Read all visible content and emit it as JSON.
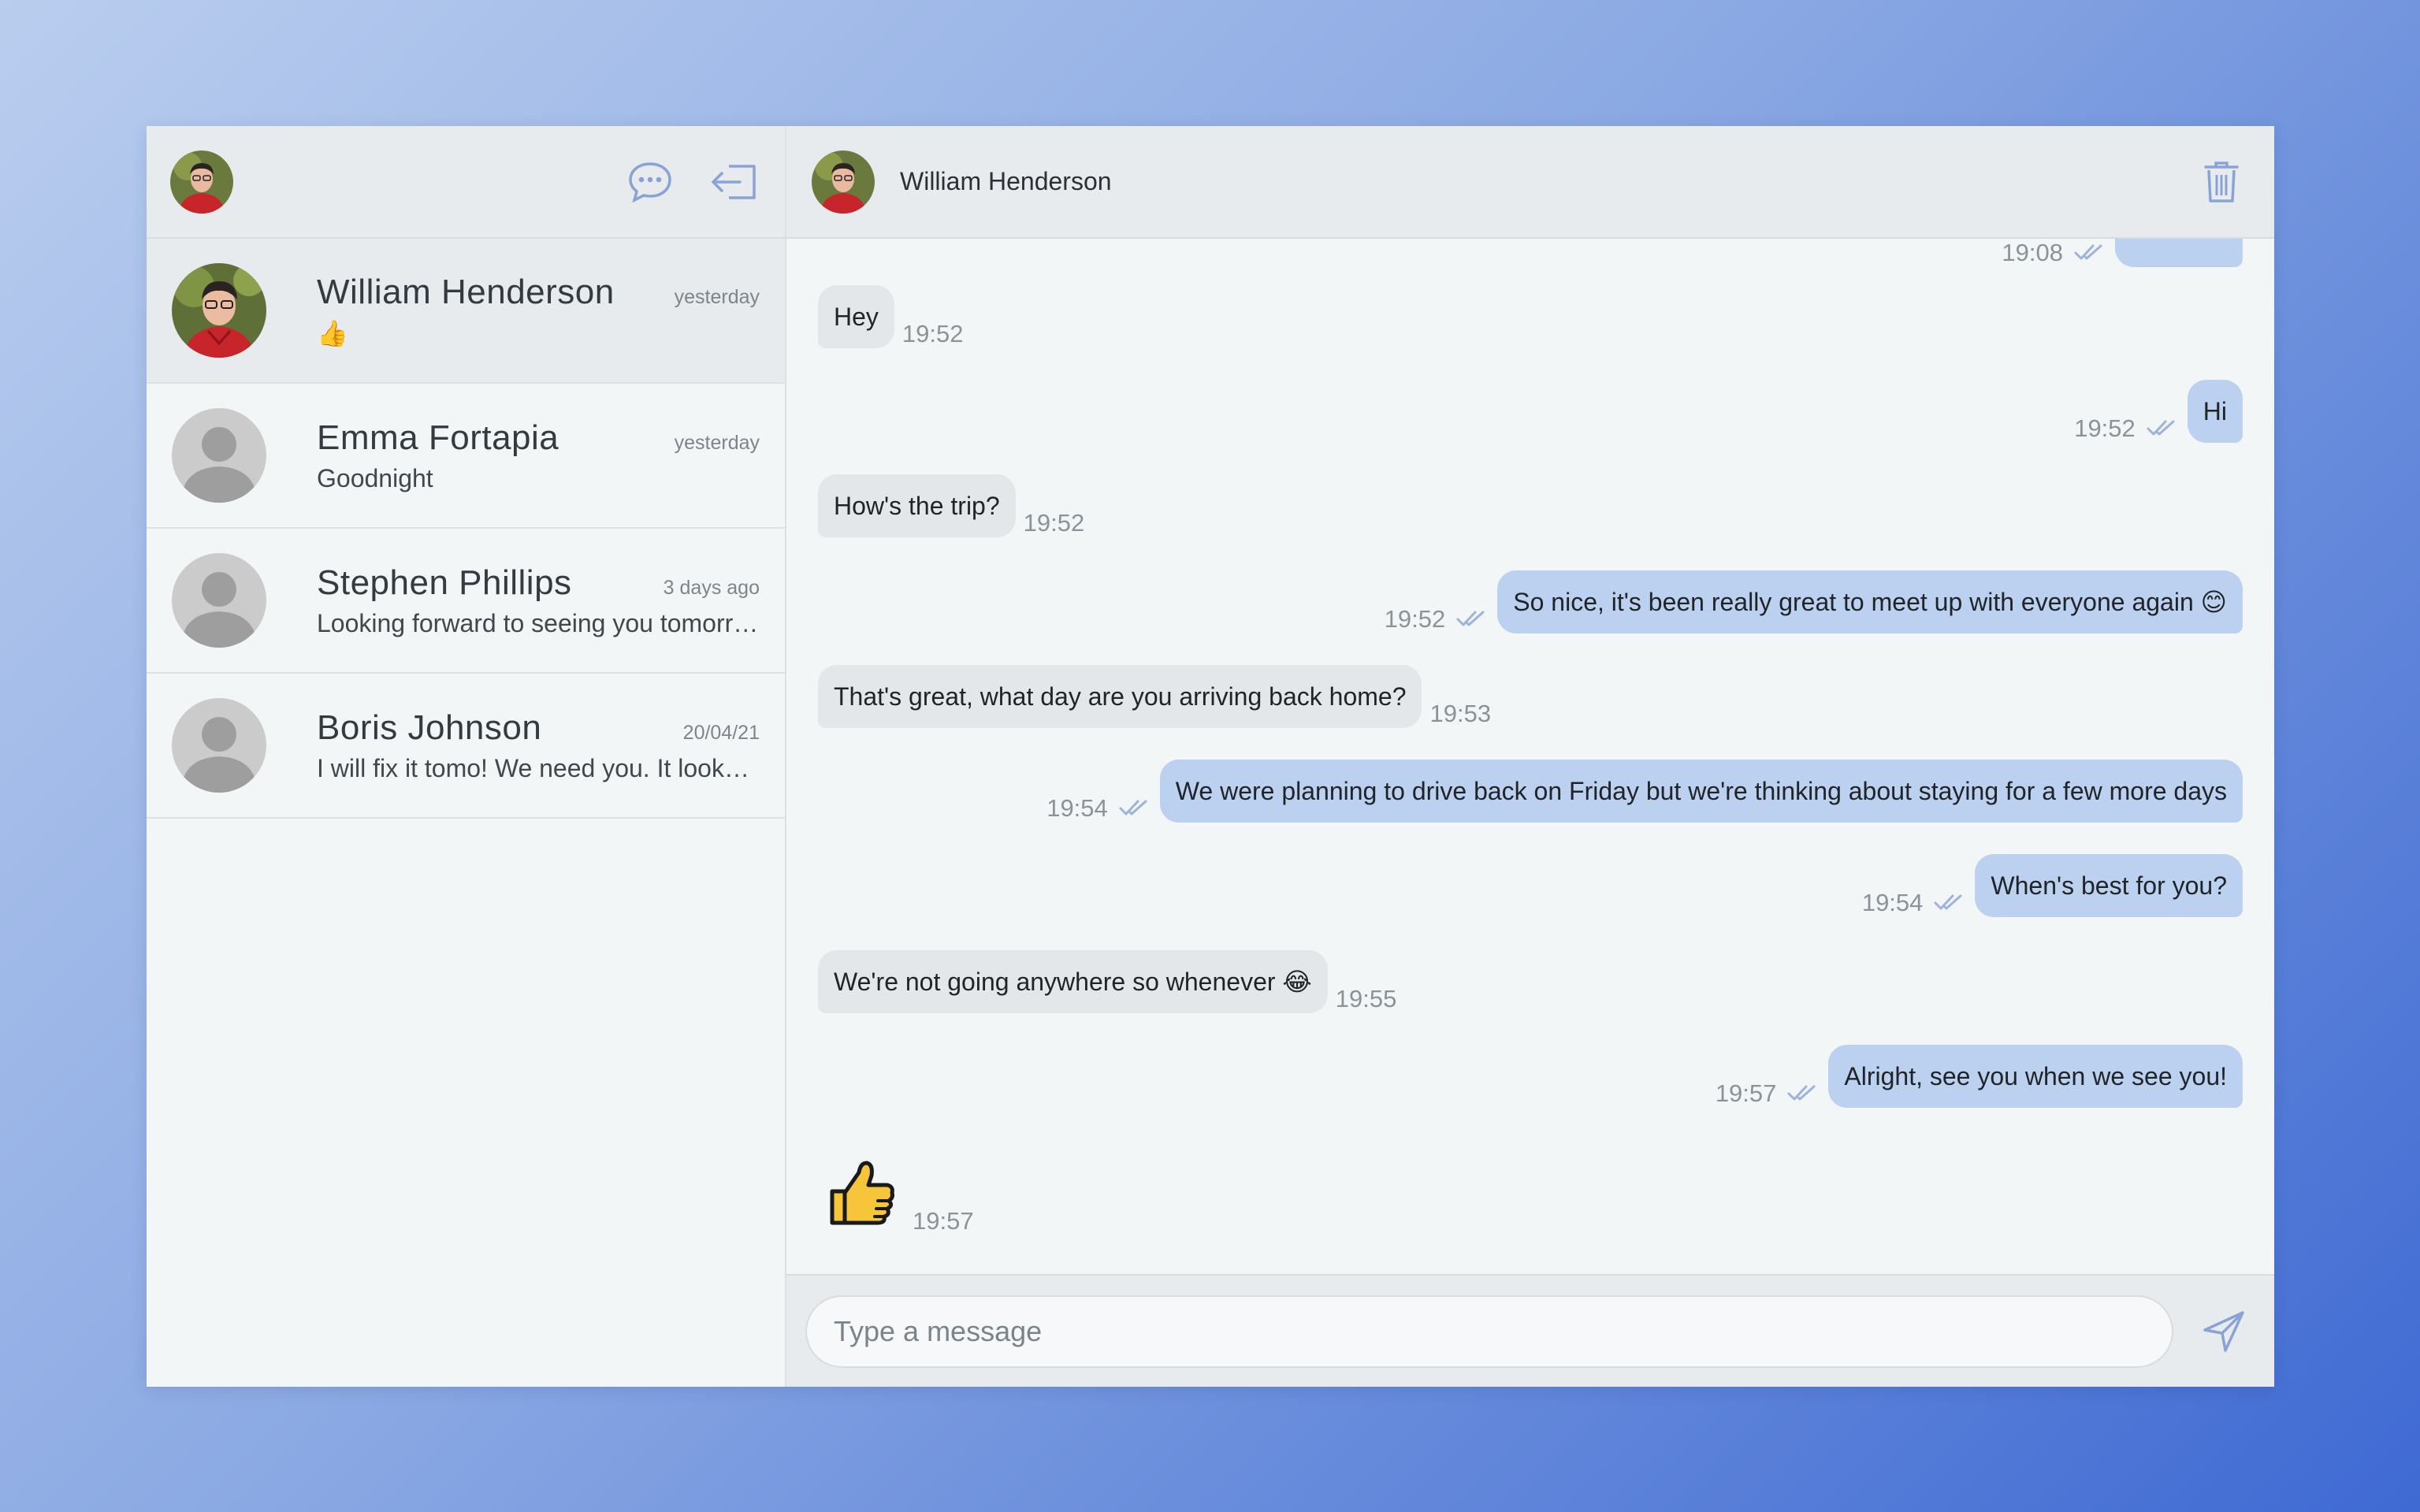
{
  "sidebar": {
    "icons": {
      "new_chat": "chat-bubble-icon",
      "logout": "logout-icon"
    },
    "conversations": [
      {
        "name": "William Henderson",
        "when": "yesterday",
        "preview": "👍",
        "active": true
      },
      {
        "name": "Emma Fortapia",
        "when": "yesterday",
        "preview": "Goodnight"
      },
      {
        "name": "Stephen Phillips",
        "when": "3 days ago",
        "preview": "Looking forward to seeing you tomorrow"
      },
      {
        "name": "Boris Johnson",
        "when": "20/04/21",
        "preview": "I will fix it tomo! We need you. It looks great"
      }
    ]
  },
  "chat": {
    "title": "William Henderson",
    "delete_icon": "trash-icon",
    "partial_top_time": "19:08",
    "messages": [
      {
        "dir": "in",
        "text": "Hey",
        "time": "19:52"
      },
      {
        "dir": "out",
        "text": "Hi",
        "time": "19:52"
      },
      {
        "dir": "in",
        "text": "How's the trip?",
        "time": "19:52"
      },
      {
        "dir": "out",
        "text": "So nice, it's been really great to meet up with everyone again 😊",
        "time": "19:52"
      },
      {
        "dir": "in",
        "text": "That's great, what day are you arriving back home?",
        "time": "19:53"
      },
      {
        "dir": "out",
        "text": "We were planning to drive back on Friday but we're thinking about staying for a few more days",
        "time": "19:54"
      },
      {
        "dir": "out",
        "text": "When's best for you?",
        "time": "19:54"
      },
      {
        "dir": "in",
        "text": "We're not going anywhere so whenever 😂",
        "time": "19:55"
      },
      {
        "dir": "out",
        "text": "Alright, see you when we see you!",
        "time": "19:57"
      },
      {
        "dir": "in",
        "text": "👍",
        "time": "19:57",
        "emoji_only": true
      }
    ],
    "composer": {
      "placeholder": "Type a message",
      "send_icon": "send-icon"
    }
  },
  "colors": {
    "accent": "#8aa3d6",
    "outgoing_bubble": "#bcd0ef",
    "incoming_bubble": "#e4e7ea"
  }
}
